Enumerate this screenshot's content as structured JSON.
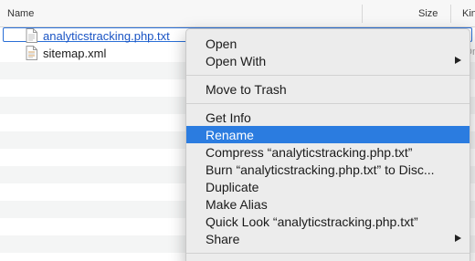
{
  "header": {
    "name": "Name",
    "size": "Size",
    "kind": "Kin"
  },
  "files": [
    {
      "name": "analyticstracking.php.txt",
      "kind_fragment": ""
    },
    {
      "name": "sitemap.xml",
      "kind_fragment": "Dn"
    }
  ],
  "menu": {
    "items": [
      {
        "label": "Open"
      },
      {
        "label": "Open With"
      },
      {
        "label": "Move to Trash"
      },
      {
        "label": "Get Info"
      },
      {
        "label": "Rename",
        "highlighted": true
      },
      {
        "label": "Compress “analyticstracking.php.txt”"
      },
      {
        "label": "Burn “analyticstracking.php.txt” to Disc..."
      },
      {
        "label": "Duplicate"
      },
      {
        "label": "Make Alias"
      },
      {
        "label": "Quick Look “analyticstracking.php.txt”"
      },
      {
        "label": "Share"
      }
    ]
  },
  "colors": {
    "selection": "#2b7ce0",
    "menu_bg": "#ececec"
  }
}
